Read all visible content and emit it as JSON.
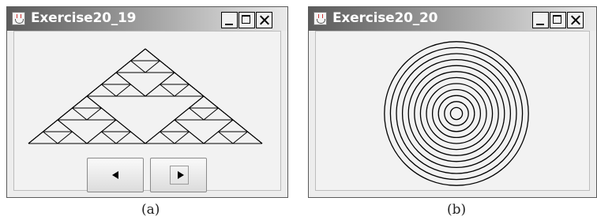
{
  "window_a": {
    "title": "Exercise20_19",
    "buttons": {
      "prev_icon": "left-triangle-icon",
      "next_icon": "right-triangle-icon"
    },
    "caption": "(a)"
  },
  "window_b": {
    "title": "Exercise20_20",
    "caption": "(b)",
    "circle_count": 12
  },
  "titlebar_controls": [
    "minimize-icon",
    "maximize-icon",
    "close-icon"
  ]
}
